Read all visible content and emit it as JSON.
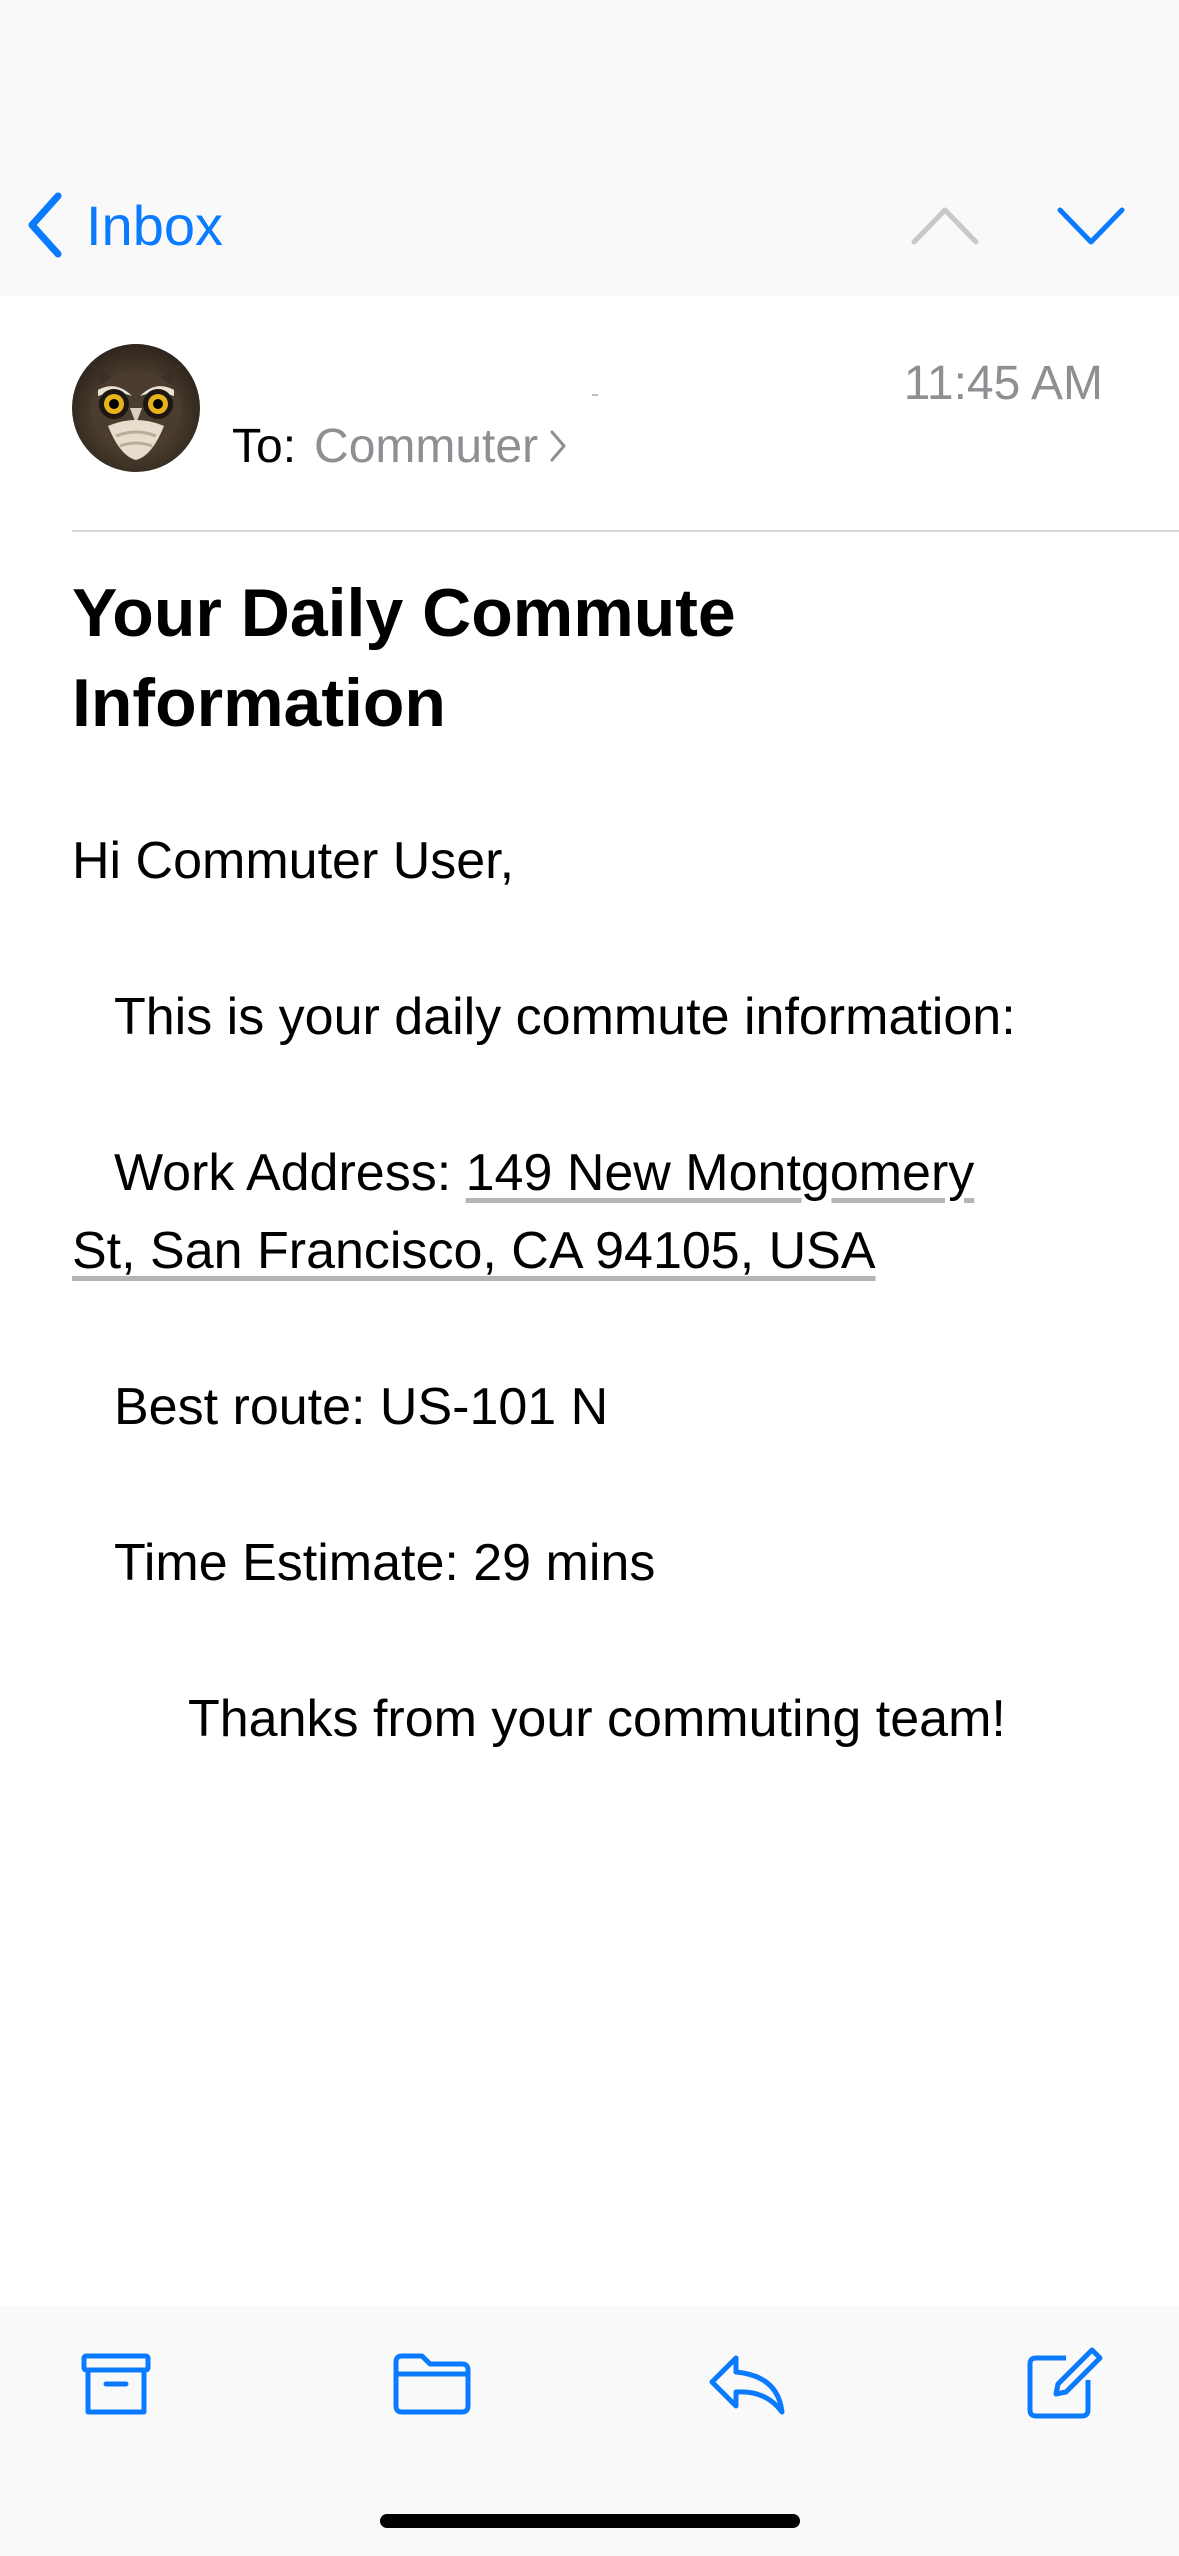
{
  "nav": {
    "back_label": "Inbox"
  },
  "message": {
    "time": "11:45 AM",
    "to_label": "To:",
    "recipient": "Commuter",
    "subject": "Your Daily Commute Information"
  },
  "body": {
    "greeting": "Hi Commuter User,",
    "intro": "This is your daily commute information:",
    "work_prefix": "Work Address: ",
    "address_line1": "149 New Montgomery",
    "address_line2": "St, San Francisco, CA 94105, USA",
    "route": "Best route: US-101 N",
    "estimate": "Time Estimate: 29 mins",
    "signoff": "Thanks from your commuting team!"
  },
  "toolbar": {
    "icons": [
      "archive-icon",
      "folder-icon",
      "reply-icon",
      "compose-icon"
    ]
  },
  "colors": {
    "accent": "#0a7aff",
    "secondary_text": "#8e8e93",
    "bar_background": "#f9f9f9"
  }
}
